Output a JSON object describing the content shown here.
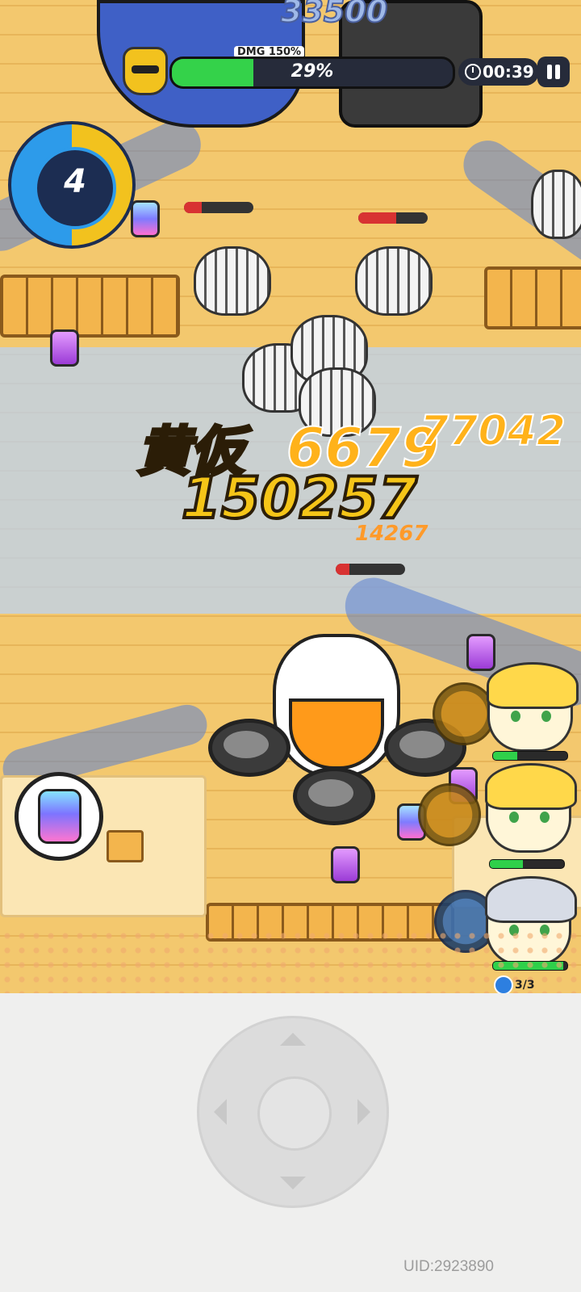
{
  "hud": {
    "top_score": "33500",
    "dmg_label": "DMG 150%",
    "boss_hp_text": "29%",
    "boss_hp_fraction": 0.29,
    "timer_text": "00:39",
    "wave_number": "4",
    "pause_icon": "pause-icon",
    "clock_icon": "clock-icon"
  },
  "damage_numbers": {
    "big": "150257",
    "kanji": "黄仮",
    "mid": "6679",
    "right": "77042",
    "small": "14267"
  },
  "enemies": {
    "hp_fractions": [
      0.25,
      0.55,
      0.2
    ]
  },
  "heroes": [
    {
      "name": "hero-1",
      "hp_fraction": 0.33
    },
    {
      "name": "hero-2",
      "hp_fraction": 0.45
    },
    {
      "name": "hero-3",
      "hp_fraction": 0.95
    }
  ],
  "revive": {
    "count_text": "3/3"
  },
  "footer": {
    "uid_text": "UID:2923890"
  },
  "colors": {
    "hp_green": "#34d24a",
    "hp_red": "#d83232",
    "accent_yellow": "#f5c518",
    "accent_blue": "#2d9bea"
  }
}
